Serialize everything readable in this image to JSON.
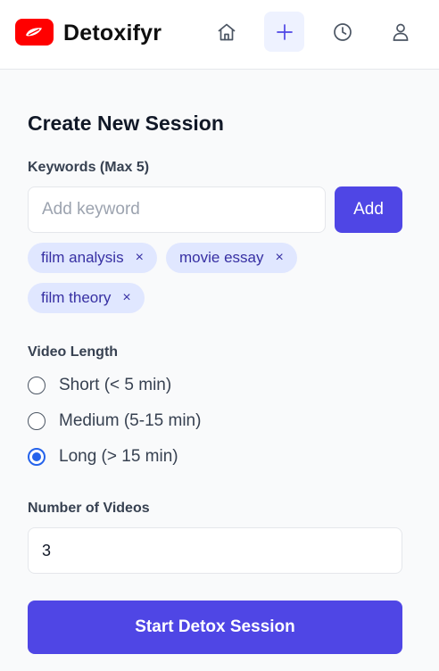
{
  "header": {
    "brand": "Detoxifyr",
    "nav": [
      {
        "icon": "home-icon"
      },
      {
        "icon": "plus-icon",
        "active": true
      },
      {
        "icon": "clock-icon"
      },
      {
        "icon": "user-icon"
      }
    ]
  },
  "form": {
    "title": "Create New Session",
    "keywords": {
      "label": "Keywords (Max 5)",
      "placeholder": "Add keyword",
      "value": "",
      "add_label": "Add",
      "chips": [
        "film analysis",
        "movie essay",
        "film theory"
      ],
      "remove_glyph": "×"
    },
    "video_length": {
      "label": "Video Length",
      "options": [
        {
          "label": "Short (< 5 min)",
          "checked": false
        },
        {
          "label": "Medium (5-15 min)",
          "checked": false
        },
        {
          "label": "Long (> 15 min)",
          "checked": true
        }
      ]
    },
    "num_videos": {
      "label": "Number of Videos",
      "value": "3"
    },
    "submit_label": "Start Detox Session"
  },
  "colors": {
    "accent": "#4f46e5",
    "chip_bg": "#e0e7ff",
    "chip_text": "#3730a3",
    "radio_checked": "#2563eb",
    "logo_red": "#ff0000"
  }
}
